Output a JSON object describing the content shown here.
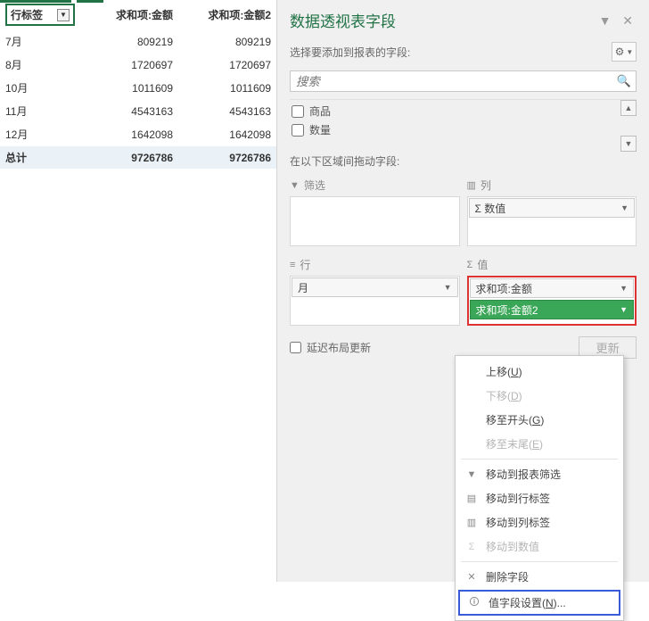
{
  "pivot": {
    "row_header": "行标签",
    "col1": "求和项:金额",
    "col2": "求和项:金额2",
    "rows": [
      {
        "label": "7月",
        "v1": "809219",
        "v2": "809219"
      },
      {
        "label": "8月",
        "v1": "1720697",
        "v2": "1720697"
      },
      {
        "label": "10月",
        "v1": "1011609",
        "v2": "1011609"
      },
      {
        "label": "11月",
        "v1": "4543163",
        "v2": "4543163"
      },
      {
        "label": "12月",
        "v1": "1642098",
        "v2": "1642098"
      }
    ],
    "total_label": "总计",
    "total_v1": "9726786",
    "total_v2": "9726786"
  },
  "panel": {
    "title": "数据透视表字段",
    "subhead": "选择要添加到报表的字段:",
    "search_placeholder": "搜索",
    "fields": {
      "f1": "商品",
      "f2": "数量"
    },
    "drag_label": "在以下区域间拖动字段:",
    "zones": {
      "filter": "筛选",
      "columns": "列",
      "rows": "行",
      "values": "值"
    },
    "col_pill": "Σ 数值",
    "row_pill": "月",
    "val_pill1": "求和项:金额",
    "val_pill2": "求和项:金额2",
    "defer": "延迟布局更新",
    "update_btn": "更新"
  },
  "menu": {
    "up": {
      "t": "上移(",
      "u": "U",
      "s": ")"
    },
    "down": {
      "t": "下移(",
      "u": "D",
      "s": ")"
    },
    "begin": {
      "t": "移至开头(",
      "u": "G",
      "s": ")"
    },
    "end": {
      "t": "移至末尾(",
      "u": "E",
      "s": ")"
    },
    "tofilter": "移动到报表筛选",
    "torow": "移动到行标签",
    "tocol": "移动到列标签",
    "toval": "移动到数值",
    "remove": "删除字段",
    "settings": {
      "t": "值字段设置(",
      "u": "N",
      "s": ")..."
    }
  }
}
